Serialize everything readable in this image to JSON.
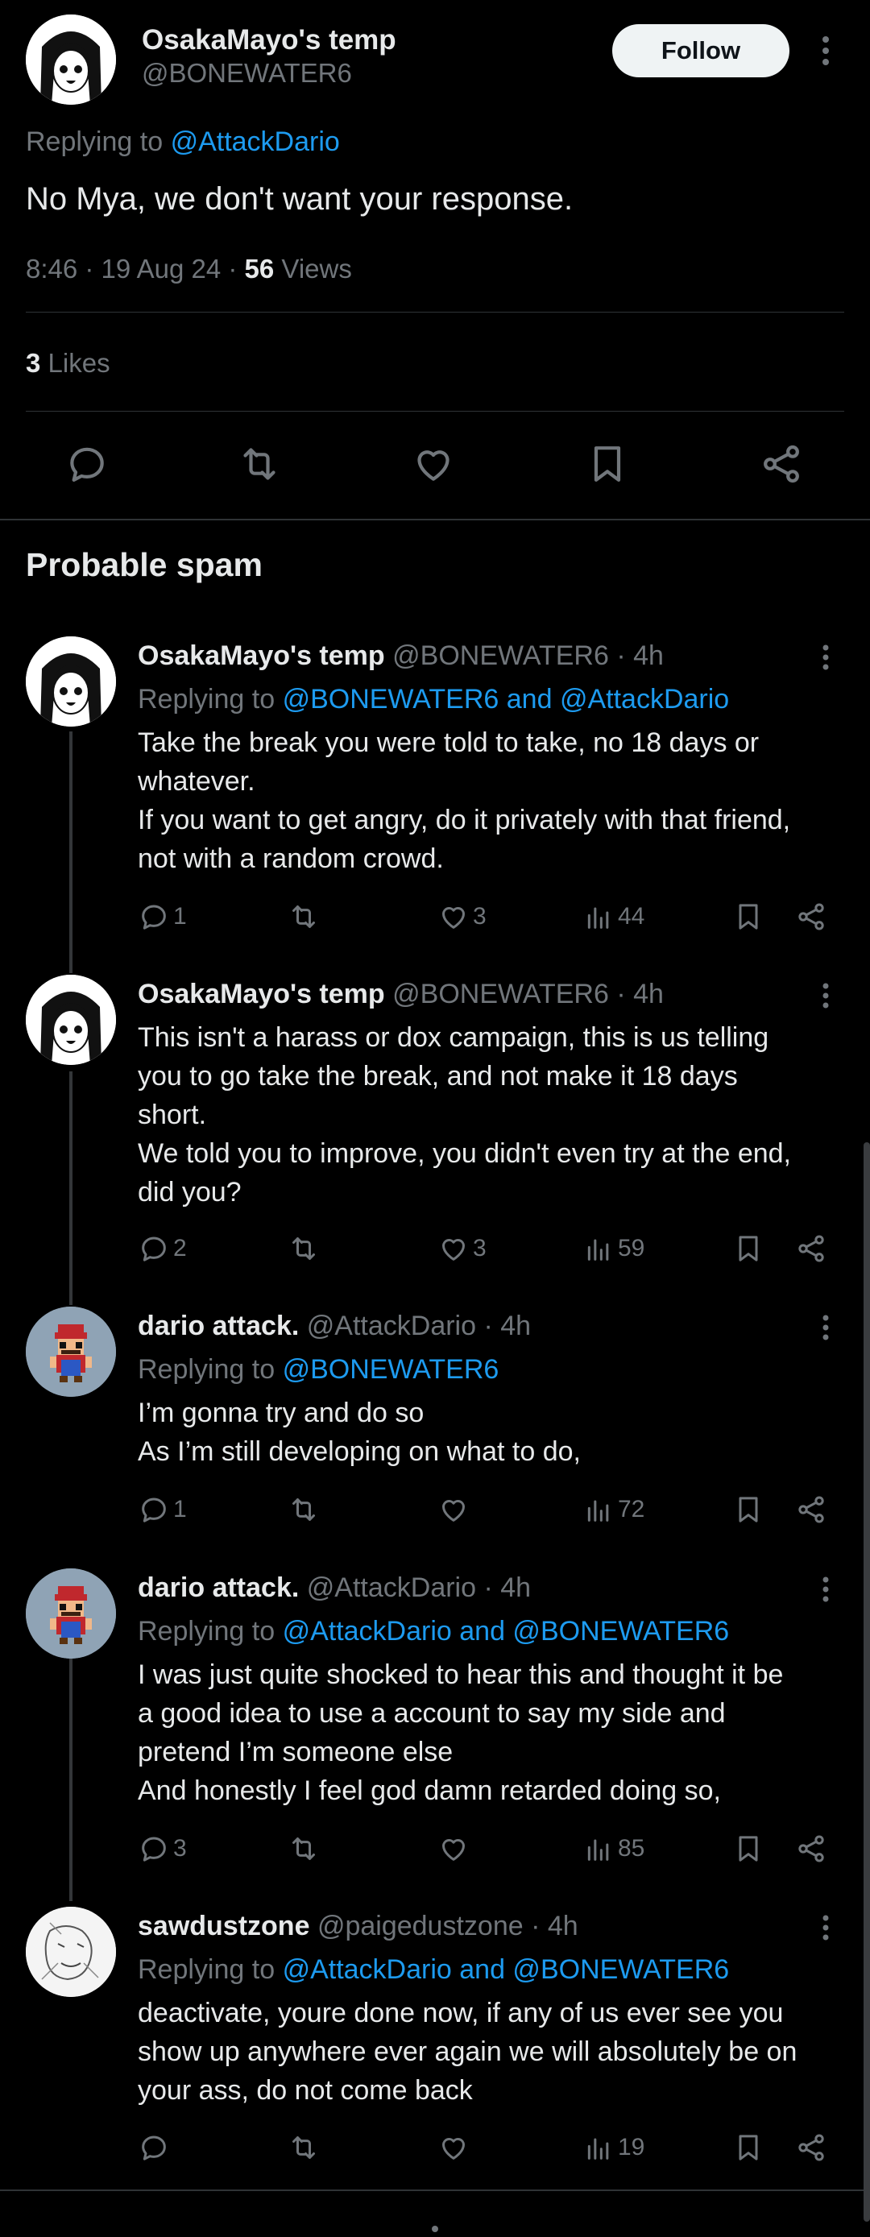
{
  "main_tweet": {
    "name": "OsakaMayo's temp",
    "handle": "@BONEWATER6",
    "follow_label": "Follow",
    "replying_prefix": "Replying to",
    "replying_to": "@AttackDario",
    "text": "No Mya, we don't want your response.",
    "time": "8:46 · 19 Aug 24 · ",
    "views_count": "56",
    "views_label": "Views",
    "likes_count": "3",
    "likes_label": "Likes",
    "actions": [
      "reply-icon",
      "retweet-icon",
      "like-icon",
      "bookmark-icon",
      "share-icon"
    ]
  },
  "section": {
    "title": "Probable spam"
  },
  "replies": [
    {
      "name": "OsakaMayo's temp",
      "handle": "@BONEWATER6 · 4h",
      "replying_prefix": "Replying to",
      "replying_to": "@BONEWATER6 and @AttackDario",
      "lines": [
        "Take the break you were told to take, no 18 days or",
        "whatever.",
        "If you want to get angry, do it privately with that friend,",
        "not with a random crowd."
      ],
      "reply_count": "1",
      "retweet_count": "",
      "like_count": "3",
      "view_count": "44"
    },
    {
      "name": "OsakaMayo's temp",
      "handle": "@BONEWATER6 · 4h",
      "replying_prefix": "",
      "replying_to": "",
      "lines": [
        "This isn't a harass or dox campaign, this is us telling",
        "you to go take the break, and not make it 18 days",
        "short.",
        "We told you to improve, you didn't even try at the end,",
        "did you?"
      ],
      "reply_count": "2",
      "retweet_count": "",
      "like_count": "3",
      "view_count": "59"
    },
    {
      "name": "dario attack.",
      "handle": "@AttackDario · 4h",
      "replying_prefix": "Replying to",
      "replying_to": "@BONEWATER6",
      "lines": [
        "I’m gonna try and do so",
        "As I’m still developing on what to do,"
      ],
      "reply_count": "1",
      "retweet_count": "",
      "like_count": "",
      "view_count": "72"
    },
    {
      "name": "dario attack.",
      "handle": "@AttackDario · 4h",
      "replying_prefix": "Replying to",
      "replying_to": "@AttackDario and @BONEWATER6",
      "lines": [
        "I was just quite shocked to hear this and thought it be",
        "a good idea to use a account to say my side and",
        "pretend I’m someone else",
        "And honestly I feel god damn retarded doing so,"
      ],
      "reply_count": "3",
      "retweet_count": "",
      "like_count": "",
      "view_count": "85"
    },
    {
      "name": "sawdustzone",
      "handle": "@paigedustzone · 4h",
      "replying_prefix": "Replying to",
      "replying_to": "@AttackDario and @BONEWATER6",
      "lines": [
        "deactivate, youre done now, if any of us ever see you",
        "show up anywhere ever again we will absolutely be on",
        "your ass, do not come back"
      ],
      "reply_count": "",
      "retweet_count": "",
      "like_count": "",
      "view_count": "19"
    }
  ],
  "colors": {
    "background": "#000000",
    "text": "#e7e9ea",
    "secondary": "#71767b",
    "link": "#1d9bf0",
    "divider": "#2f3336"
  }
}
